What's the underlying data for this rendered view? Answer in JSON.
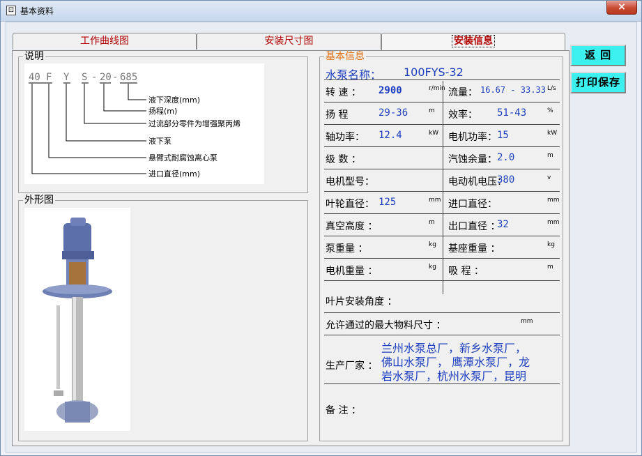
{
  "window": {
    "title": "基本资料",
    "close": "×"
  },
  "tabs": [
    "工作曲线图",
    "安装尺寸图",
    "安装信息"
  ],
  "buttons": {
    "back": "返  回",
    "print_save": "打印保存"
  },
  "note": {
    "title": "说明",
    "code": [
      "40",
      "F",
      "Y",
      "S",
      "-",
      "20",
      "-",
      "685"
    ],
    "legend": [
      "液下深度(mm)",
      "扬程(m)",
      "过流部分零件为增强聚丙烯",
      "液下泵",
      "悬臂式耐腐蚀离心泵",
      "进口直径(mm)"
    ]
  },
  "appearance": {
    "title": "外形图"
  },
  "info": {
    "title": "基本信息",
    "pump_name_label": "水泵名称：",
    "pump_name": "100FYS-32",
    "rows": [
      {
        "l_label": "转 速 ：",
        "l_val": "2900",
        "l_unit": "r/min",
        "r_label": "流量：",
        "r_val": "16.67 - 33.33",
        "r_unit": "L/s"
      },
      {
        "l_label": "扬 程",
        "l_val": "29-36",
        "l_unit": "m",
        "r_label": "效率：",
        "r_val": "51-43",
        "r_unit": "%"
      },
      {
        "l_label": "轴功率：",
        "l_val": "12.4",
        "l_unit": "kW",
        "r_label": "电机功率：",
        "r_val": "15",
        "r_unit": "kW"
      },
      {
        "l_label": "级 数 ：",
        "l_val": "",
        "l_unit": "",
        "r_label": "汽蚀余量：",
        "r_val": "2.0",
        "r_unit": "m"
      },
      {
        "l_label": "电机型号：",
        "l_val": "",
        "l_unit": "",
        "r_label": "电动机电压：",
        "r_val": "380",
        "r_unit": "v"
      },
      {
        "l_label": "叶轮直径：",
        "l_val": "125",
        "l_unit": "mm",
        "r_label": "进口直径：",
        "r_val": "",
        "r_unit": "mm"
      },
      {
        "l_label": "真空高度 ：",
        "l_val": "",
        "l_unit": "m",
        "r_label": "出口直径 ：",
        "r_val": "32",
        "r_unit": "mm"
      },
      {
        "l_label": "泵重量 ：",
        "l_val": "",
        "l_unit": "kg",
        "r_label": "基座重量 ：",
        "r_val": "",
        "r_unit": "kg"
      },
      {
        "l_label": "电机重量 ：",
        "l_val": "",
        "l_unit": "kg",
        "r_label": "吸 程 ：",
        "r_val": "",
        "r_unit": "m"
      }
    ],
    "blade_angle": "叶片安装角度 ：",
    "max_size": "允许通过的最大物料尺寸 ：",
    "max_size_unit": "mm",
    "manufacturer_label": "生产厂家 ：",
    "manufacturer_lines": [
      "兰州水泵总厂，新乡水泵厂，",
      "佛山水泵厂， 鹰潭水泵厂，龙",
      "岩水泵厂，杭州水泵厂，昆明"
    ],
    "remark_label": "备  注 ："
  }
}
